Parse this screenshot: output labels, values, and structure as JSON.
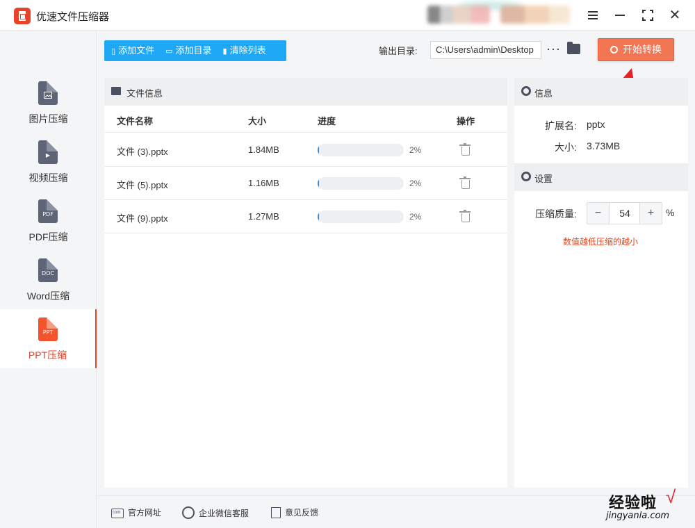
{
  "app": {
    "title": "优速文件压缩器"
  },
  "window_controls": {
    "menu_icon": "menu-icon",
    "minimize_icon": "minimize-icon",
    "maximize_icon": "maximize-icon",
    "close_icon": "close-icon"
  },
  "sidebar": {
    "items": [
      {
        "label": "图片压缩",
        "icon": "image-file-icon",
        "glyph": ""
      },
      {
        "label": "视频压缩",
        "icon": "video-file-icon",
        "glyph": "▶"
      },
      {
        "label": "PDF压缩",
        "icon": "pdf-file-icon",
        "glyph": "PDF"
      },
      {
        "label": "Word压缩",
        "icon": "doc-file-icon",
        "glyph": "DOC"
      },
      {
        "label": "PPT压缩",
        "icon": "ppt-file-icon",
        "glyph": "PPT",
        "active": true
      }
    ]
  },
  "toolbar": {
    "add_file": "添加文件",
    "add_dir": "添加目录",
    "clear_list": "清除列表",
    "output_label": "输出目录:",
    "output_path": "C:\\Users\\admin\\Desktop",
    "more": "···",
    "start": "开始转换"
  },
  "file_panel": {
    "title": "文件信息",
    "columns": {
      "name": "文件名称",
      "size": "大小",
      "progress": "进度",
      "action": "操作"
    },
    "rows": [
      {
        "name": "文件 (3).pptx",
        "size": "1.84MB",
        "progress": 0.02,
        "progress_text": "2%"
      },
      {
        "name": "文件 (5).pptx",
        "size": "1.16MB",
        "progress": 0.02,
        "progress_text": "2%"
      },
      {
        "name": "文件 (9).pptx",
        "size": "1.27MB",
        "progress": 0.02,
        "progress_text": "2%"
      }
    ]
  },
  "info_panel": {
    "title": "信息",
    "ext_label": "扩展名:",
    "ext_value": "pptx",
    "size_label": "大小:",
    "size_value": "3.73MB"
  },
  "settings_panel": {
    "title": "设置",
    "quality_label": "压缩质量:",
    "quality_value": "54",
    "minus": "−",
    "plus": "+",
    "unit": "%",
    "hint": "数值越低压缩的越小"
  },
  "footer": {
    "website": "官方网址",
    "wechat": "企业微信客服",
    "feedback": "意见反馈"
  },
  "watermark": {
    "text": "经验啦",
    "url": "jingyanla.com"
  },
  "colors": {
    "accent": "#e8432a",
    "toolbar_blue": "#1fa8f5",
    "progress": "#3c84d6",
    "start_button": "#f27554"
  }
}
